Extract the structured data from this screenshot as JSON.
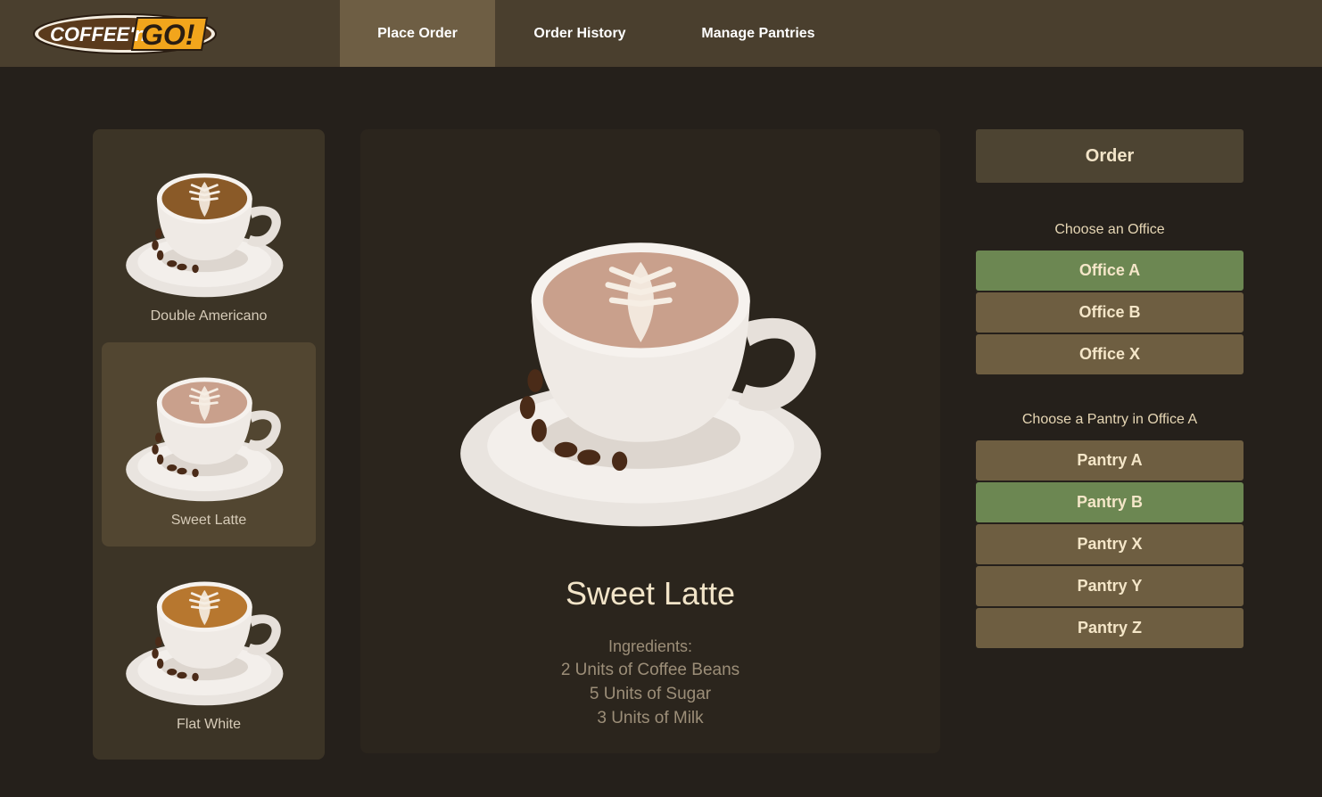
{
  "header": {
    "logo_text": "COFFEE'n GO!",
    "tabs": [
      {
        "label": "Place Order",
        "active": true
      },
      {
        "label": "Order History",
        "active": false
      },
      {
        "label": "Manage Pantries",
        "active": false
      }
    ]
  },
  "products": [
    {
      "name": "Double Americano",
      "selected": false
    },
    {
      "name": "Sweet Latte",
      "selected": true
    },
    {
      "name": "Flat White",
      "selected": false
    }
  ],
  "detail": {
    "title": "Sweet Latte",
    "ingredients_label": "Ingredients:",
    "ingredients": [
      "2 Units of Coffee Beans",
      "5 Units of Sugar",
      "3 Units of Milk"
    ]
  },
  "order": {
    "button_label": "Order",
    "office_label": "Choose an Office",
    "offices": [
      "Office A",
      "Office B",
      "Office X"
    ],
    "selected_office": "Office A",
    "pantry_label": "Choose a Pantry in Office A",
    "pantries": [
      "Pantry A",
      "Pantry B",
      "Pantry X",
      "Pantry Y",
      "Pantry Z"
    ],
    "selected_pantry": "Pantry B"
  },
  "colors": {
    "header_bg": "#4a3f2e",
    "active_tab": "#6e5e44",
    "page_bg": "#25201b",
    "selected_option": "#6c8752",
    "option": "#6e5e41"
  }
}
